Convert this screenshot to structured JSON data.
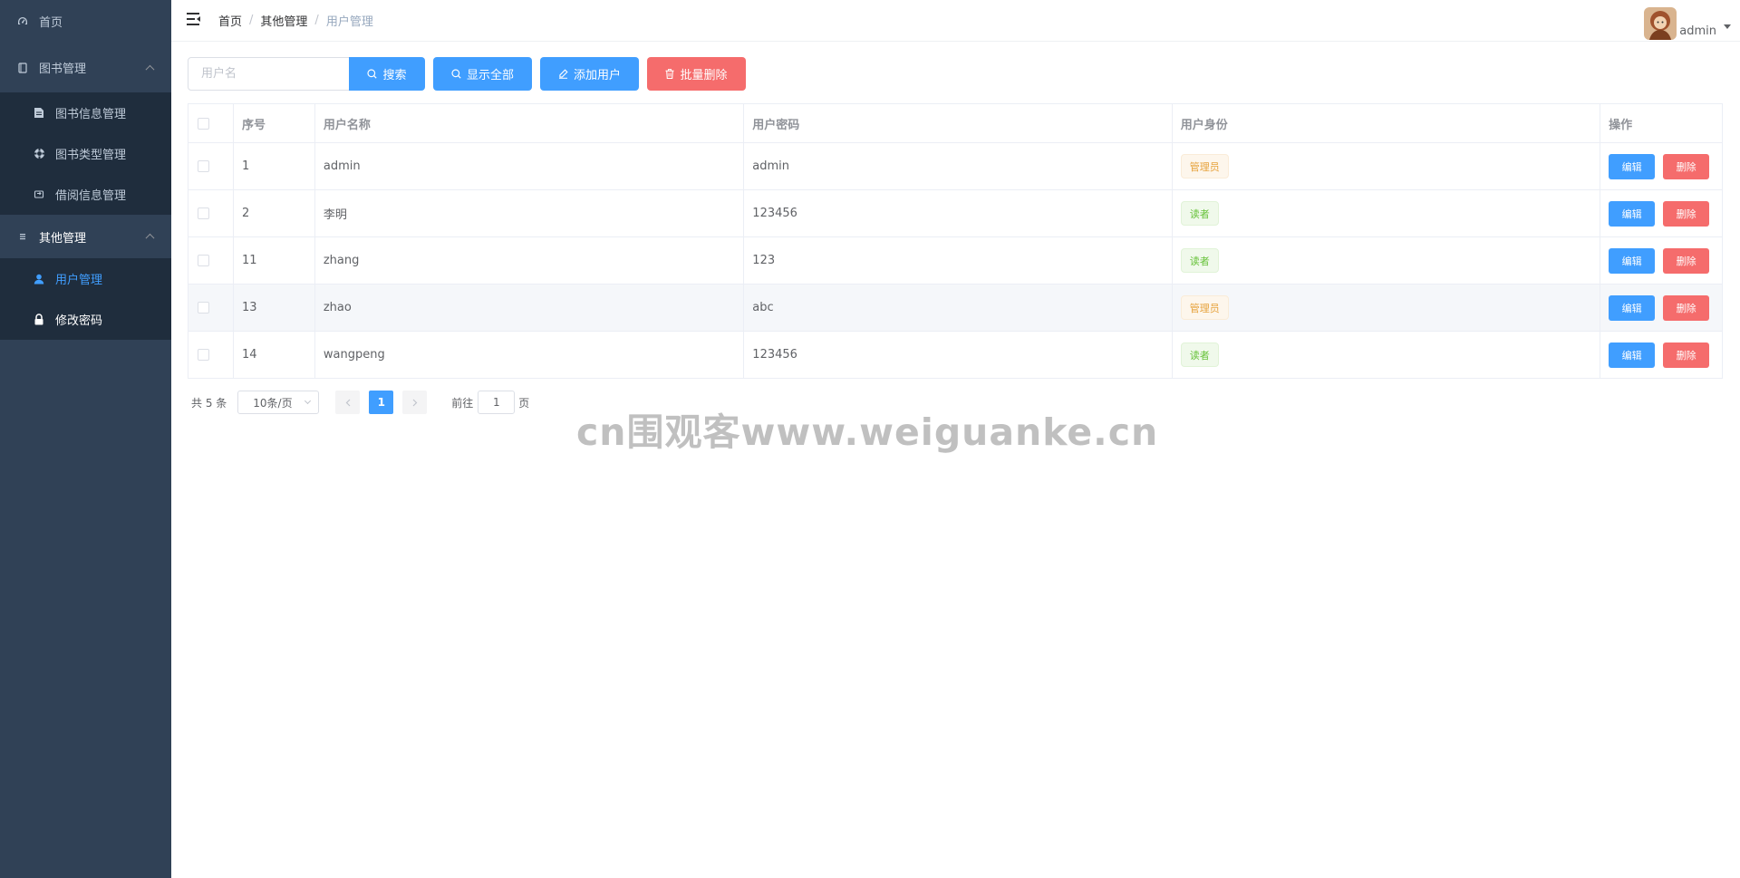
{
  "sidebar": {
    "home": "首页",
    "book_group": {
      "label": "图书管理",
      "items": [
        {
          "label": "图书信息管理"
        },
        {
          "label": "图书类型管理"
        },
        {
          "label": "借阅信息管理"
        }
      ]
    },
    "other_group": {
      "label": "其他管理",
      "items": [
        {
          "label": "用户管理"
        },
        {
          "label": "修改密码"
        }
      ]
    }
  },
  "header": {
    "breadcrumb": [
      "首页",
      "其他管理",
      "用户管理"
    ],
    "breadcrumb_separator": "/",
    "user_name": "admin"
  },
  "toolbar": {
    "search_placeholder": "用户名",
    "search_value": "",
    "search_label": "搜索",
    "show_all_label": "显示全部",
    "add_user_label": "添加用户",
    "batch_delete_label": "批量删除"
  },
  "table": {
    "columns": [
      "序号",
      "用户名称",
      "用户密码",
      "用户身份",
      "操作"
    ],
    "rows": [
      {
        "id": "1",
        "name": "admin",
        "password": "admin",
        "role": "管理员",
        "role_type": "admin"
      },
      {
        "id": "2",
        "name": "李明",
        "password": "123456",
        "role": "读者",
        "role_type": "reader"
      },
      {
        "id": "11",
        "name": "zhang",
        "password": "123",
        "role": "读者",
        "role_type": "reader"
      },
      {
        "id": "13",
        "name": "zhao",
        "password": "abc",
        "role": "管理员",
        "role_type": "admin"
      },
      {
        "id": "14",
        "name": "wangpeng",
        "password": "123456",
        "role": "读者",
        "role_type": "reader"
      }
    ],
    "edit_label": "编辑",
    "delete_label": "删除"
  },
  "pagination": {
    "total": "共 5 条",
    "page_size": "10条/页",
    "current_page": "1",
    "goto_label": "前往",
    "goto_value": "1",
    "page_suffix": "页"
  },
  "watermark": "cn围观客www.weiguanke.cn",
  "colors": {
    "sidebar_bg": "#304156",
    "submenu_bg": "#1f2d3d",
    "primary": "#409eff",
    "danger": "#f56c6c",
    "warning": "#e6a23c",
    "success": "#67c23a"
  }
}
